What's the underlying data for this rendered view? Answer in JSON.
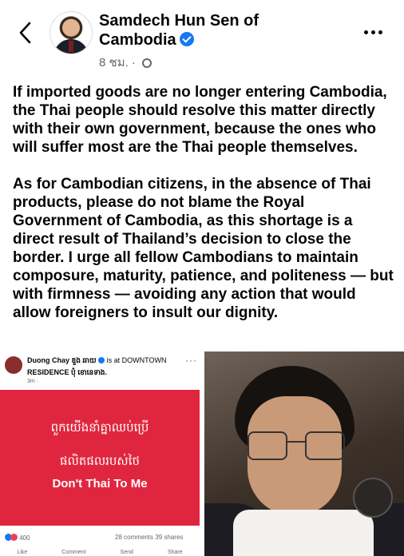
{
  "header": {
    "page_name": "Samdech Hun Sen of Cambodia",
    "time_ago": "8 ชม.",
    "separator": "·",
    "back_icon": "chevron-left-icon",
    "more_icon": "more-horizontal-icon",
    "privacy_icon": "globe-icon",
    "verified_icon": "verified-badge-icon"
  },
  "post": {
    "paragraph_1": "If imported goods are no longer entering Cambodia, the Thai people should resolve this matter directly with their own government, because the ones who will suffer most are the Thai people themselves.",
    "paragraph_2": "As for Cambodian citizens, in the absence of Thai products, please do not blame the Royal Government of Cambodia, as this shortage is a direct result of Thailand’s decision to close the border. I urge all fellow Cambodians to maintain composure, maturity, patience, and politeness — but with firmness — avoiding any action that would allow foreigners to insult our dignity."
  },
  "shared_post": {
    "author": "Duong Chay ឌួង ឆាយ",
    "checkin_text": "is at DOWNTOWN",
    "location": "RESIDENCE ប៉ុំ ខេានេទាង.",
    "time": "3m ·",
    "more": "···",
    "khmer_line_1": "ពួកយើងនាំគ្នាឈប់ប្រើ",
    "khmer_line_2": "ផលិតផលរបស់ថៃ",
    "slogan": "Don't Thai To Me",
    "reaction_count": "400",
    "comments": "28 comments",
    "shares": "39 shares",
    "actions": [
      "Like",
      "Comment",
      "Send",
      "Share"
    ],
    "card_color": "#e0263e"
  },
  "colors": {
    "verified": "#1877f2",
    "meta_text": "#65676b"
  }
}
